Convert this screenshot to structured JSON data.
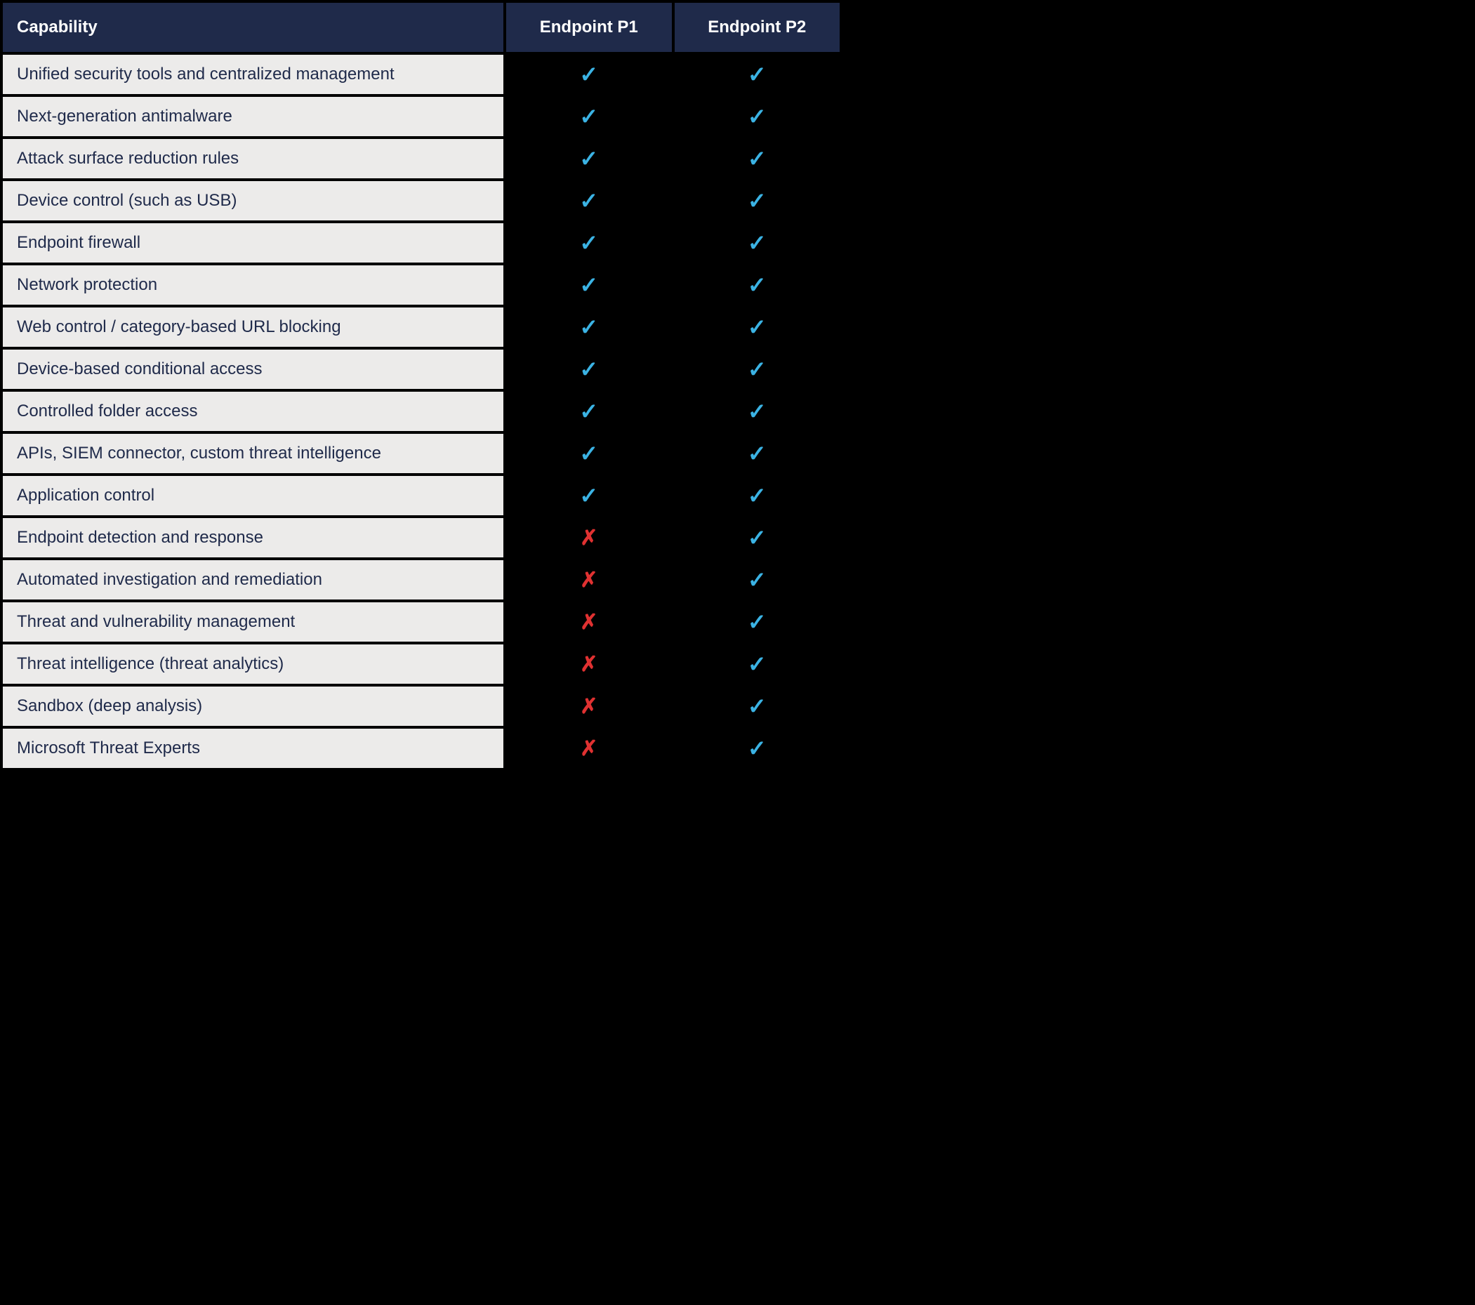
{
  "headers": {
    "capability": "Capability",
    "p1": "Endpoint P1",
    "p2": "Endpoint P2"
  },
  "icons": {
    "check": "✓",
    "cross": "✗"
  },
  "rows": [
    {
      "capability": "Unified security tools and centralized management",
      "p1": "check",
      "p2": "check"
    },
    {
      "capability": "Next-generation antimalware",
      "p1": "check",
      "p2": "check"
    },
    {
      "capability": "Attack surface reduction rules",
      "p1": "check",
      "p2": "check"
    },
    {
      "capability": "Device control (such as USB)",
      "p1": "check",
      "p2": "check"
    },
    {
      "capability": "Endpoint firewall",
      "p1": "check",
      "p2": "check"
    },
    {
      "capability": "Network protection",
      "p1": "check",
      "p2": "check"
    },
    {
      "capability": "Web control / category-based URL blocking",
      "p1": "check",
      "p2": "check"
    },
    {
      "capability": "Device-based conditional access",
      "p1": "check",
      "p2": "check"
    },
    {
      "capability": "Controlled folder access",
      "p1": "check",
      "p2": "check"
    },
    {
      "capability": "APIs, SIEM connector, custom threat intelligence",
      "p1": "check",
      "p2": "check"
    },
    {
      "capability": "Application control",
      "p1": "check",
      "p2": "check"
    },
    {
      "capability": "Endpoint detection and response",
      "p1": "cross",
      "p2": "check"
    },
    {
      "capability": "Automated investigation and remediation",
      "p1": "cross",
      "p2": "check"
    },
    {
      "capability": "Threat and vulnerability management",
      "p1": "cross",
      "p2": "check"
    },
    {
      "capability": "Threat intelligence (threat analytics)",
      "p1": "cross",
      "p2": "check"
    },
    {
      "capability": "Sandbox (deep analysis)",
      "p1": "cross",
      "p2": "check"
    },
    {
      "capability": "Microsoft Threat Experts",
      "p1": "cross",
      "p2": "check"
    }
  ]
}
